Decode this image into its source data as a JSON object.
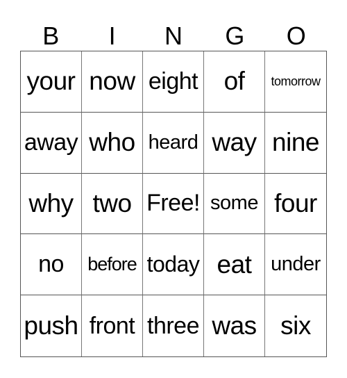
{
  "title_letters": [
    "B",
    "I",
    "N",
    "G",
    "O"
  ],
  "rows": [
    [
      {
        "text": "your",
        "size": "s-xl"
      },
      {
        "text": "now",
        "size": "s-xl"
      },
      {
        "text": "eight",
        "size": "s-l"
      },
      {
        "text": "of",
        "size": "s-xl"
      },
      {
        "text": "tomorrow",
        "size": "s-tiny"
      }
    ],
    [
      {
        "text": "away",
        "size": "s-l"
      },
      {
        "text": "who",
        "size": "s-xl"
      },
      {
        "text": "heard",
        "size": "s-s"
      },
      {
        "text": "way",
        "size": "s-xl"
      },
      {
        "text": "nine",
        "size": "s-xl"
      }
    ],
    [
      {
        "text": "why",
        "size": "s-xl"
      },
      {
        "text": "two",
        "size": "s-xl"
      },
      {
        "text": "Free!",
        "size": "s-l"
      },
      {
        "text": "some",
        "size": "s-s"
      },
      {
        "text": "four",
        "size": "s-xl"
      }
    ],
    [
      {
        "text": "no",
        "size": "s-l"
      },
      {
        "text": "before",
        "size": "s-xs"
      },
      {
        "text": "today",
        "size": "s-m"
      },
      {
        "text": "eat",
        "size": "s-xl"
      },
      {
        "text": "under",
        "size": "s-s"
      }
    ],
    [
      {
        "text": "push",
        "size": "s-xl"
      },
      {
        "text": "front",
        "size": "s-l"
      },
      {
        "text": "three",
        "size": "s-l"
      },
      {
        "text": "was",
        "size": "s-xl"
      },
      {
        "text": "six",
        "size": "s-xl"
      }
    ]
  ]
}
